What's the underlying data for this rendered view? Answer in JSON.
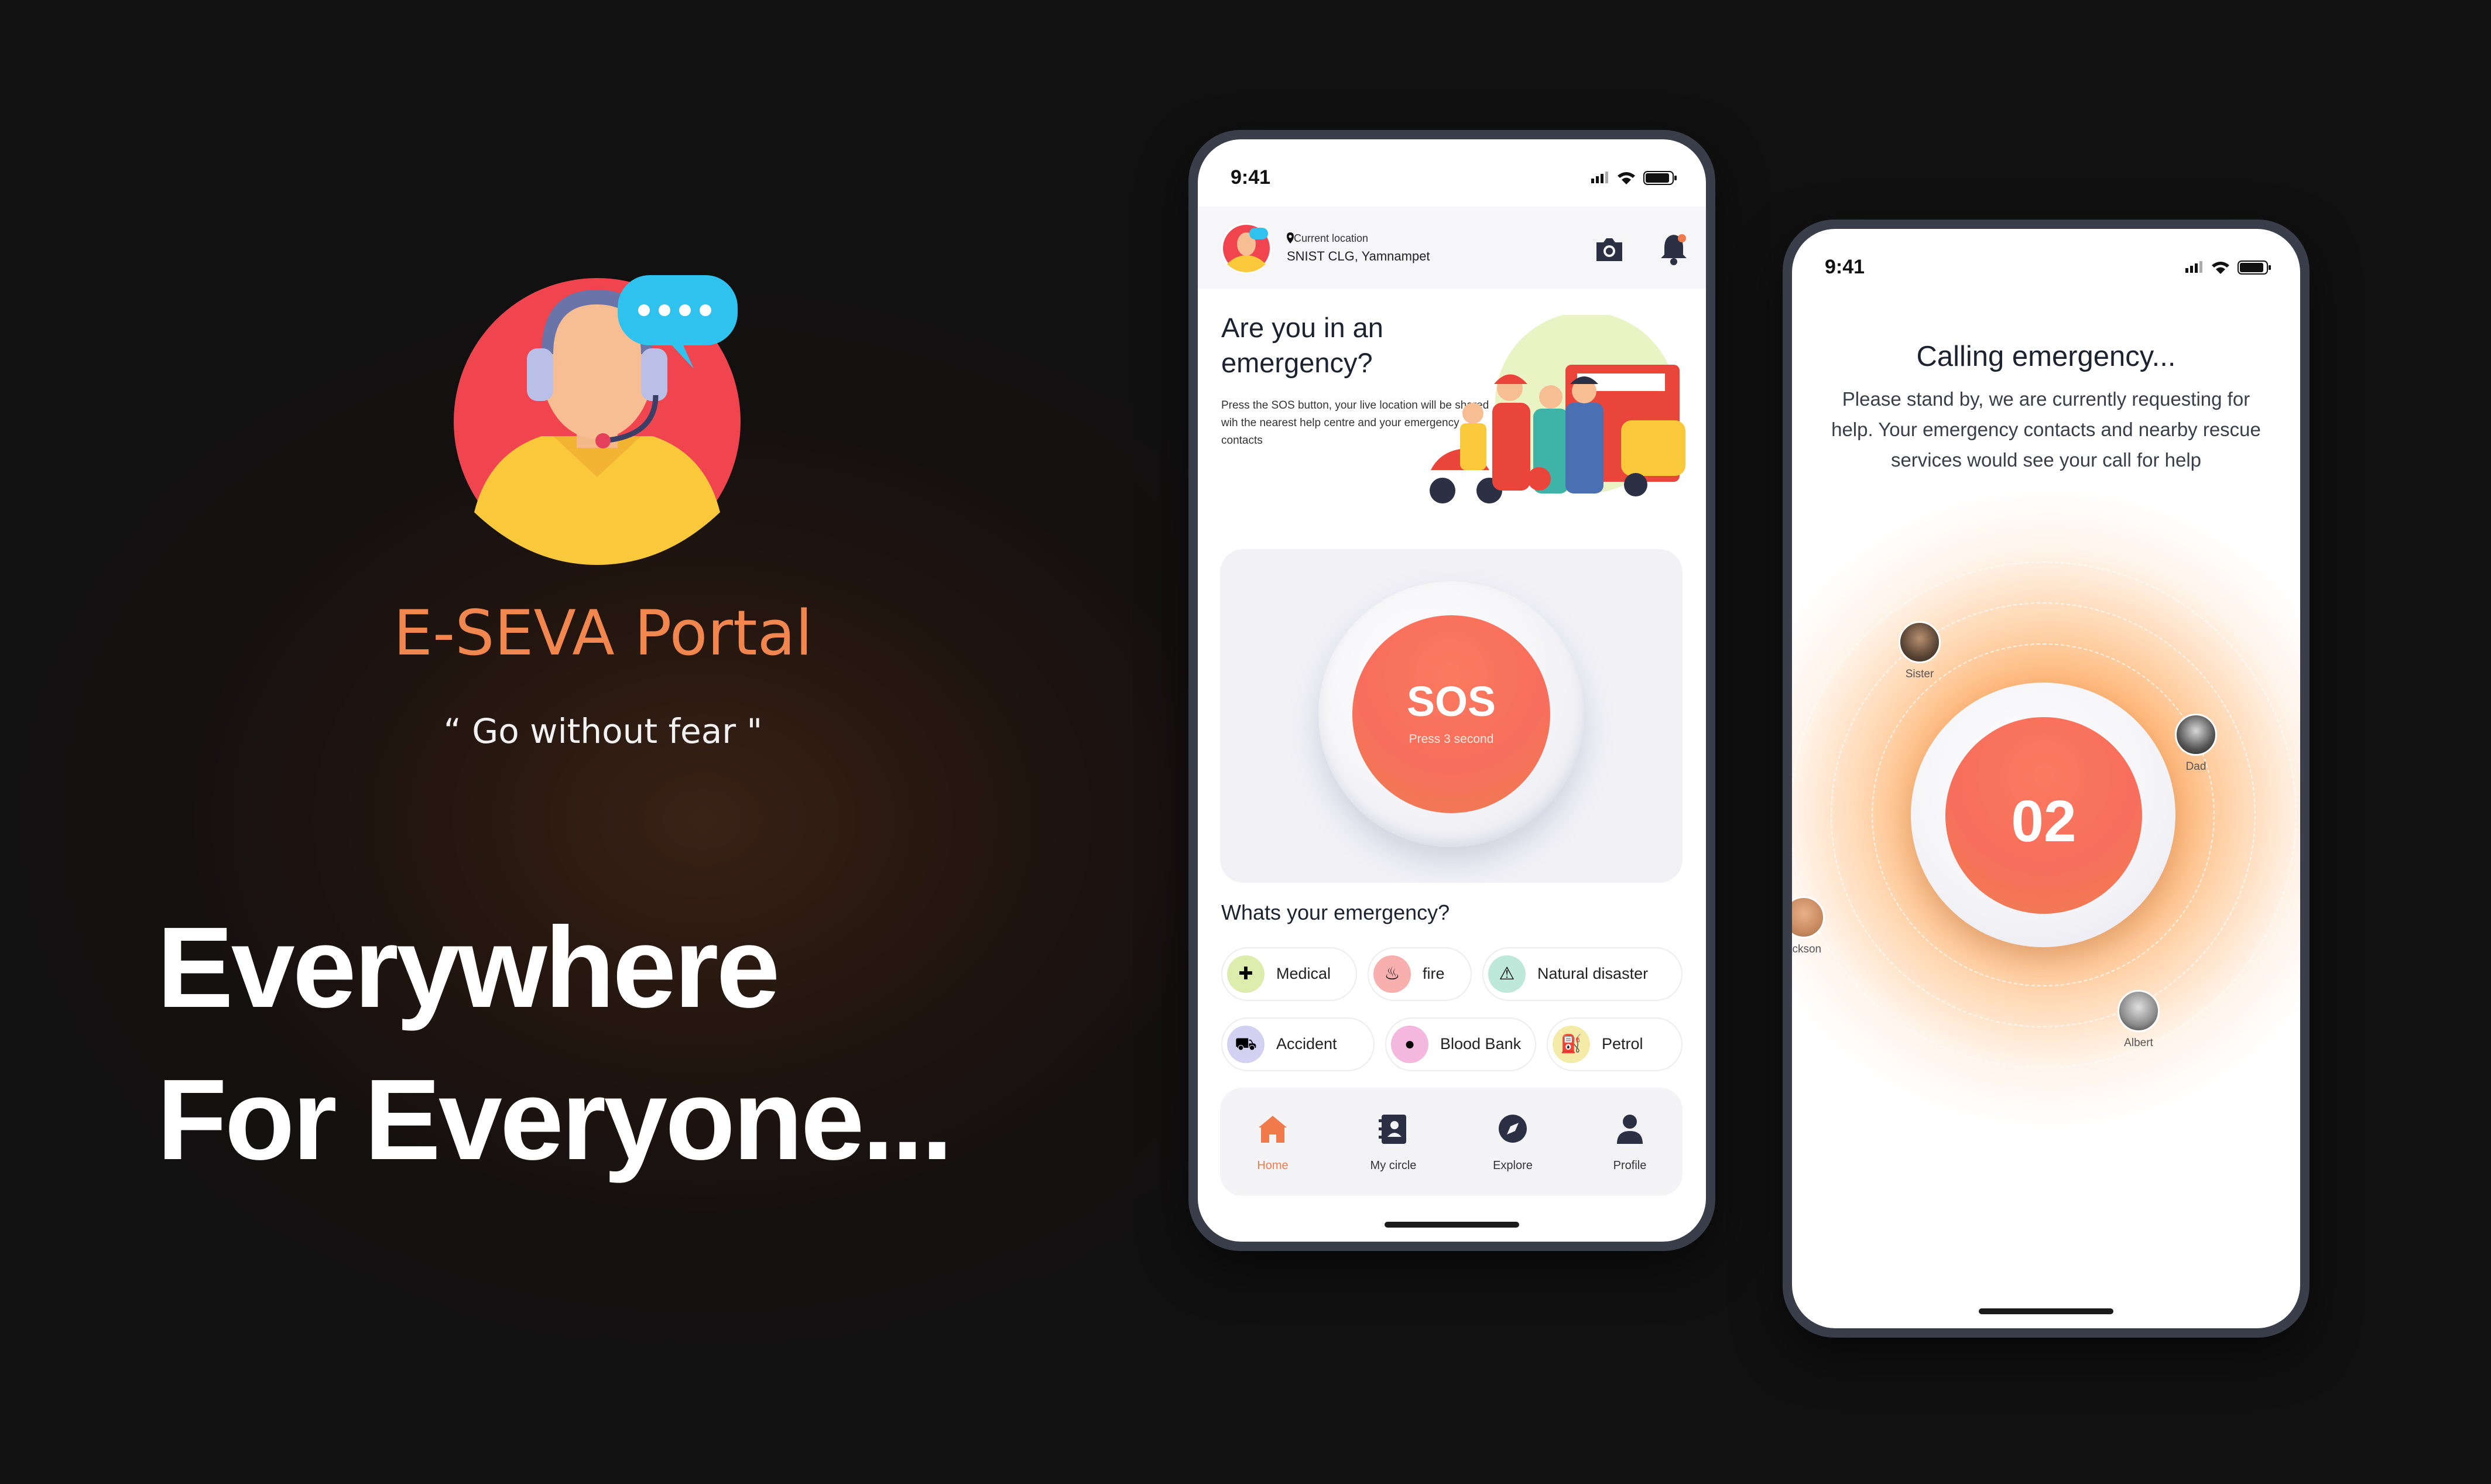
{
  "brand": {
    "title": "E-SEVA Portal",
    "tagline": "“ Go without fear \"",
    "headline_line1": "Everywhere",
    "headline_line2": "For Everyone..."
  },
  "phone_home": {
    "status_time": "9:41",
    "location_label": "Current location",
    "location_value": "SNIST CLG, Yamnampet",
    "hero_title": "Are you in an emergency?",
    "hero_desc": "Press the SOS button, your live location will be shared wih the nearest help centre and your emergency contacts",
    "sos_label": "SOS",
    "sos_sub": "Press 3 second",
    "question": "Whats your emergency?",
    "chips": [
      {
        "label": "Medical",
        "icon": "medical-kit-icon"
      },
      {
        "label": "fire",
        "icon": "fire-icon"
      },
      {
        "label": "Natural disaster",
        "icon": "disaster-icon"
      },
      {
        "label": "Accident",
        "icon": "accident-car-icon"
      },
      {
        "label": "Blood Bank",
        "icon": "blood-drop-icon"
      },
      {
        "label": "Petrol",
        "icon": "fuel-pump-icon"
      }
    ],
    "nav": [
      {
        "label": "Home",
        "icon": "home-icon"
      },
      {
        "label": "My circle",
        "icon": "contacts-book-icon"
      },
      {
        "label": "Explore",
        "icon": "compass-icon"
      },
      {
        "label": "Profile",
        "icon": "user-icon"
      }
    ]
  },
  "phone_calling": {
    "status_time": "9:41",
    "title": "Calling emergency...",
    "body": "Please stand by, we are currently requesting for help. Your emergency contacts and nearby rescue services would see your call for help",
    "counter": "02",
    "contacts": [
      "Sister",
      "Dad",
      "ackson",
      "Albert"
    ]
  },
  "colors": {
    "accent": "#f1864f",
    "sos": "#f76e5c",
    "background": "#141010"
  }
}
